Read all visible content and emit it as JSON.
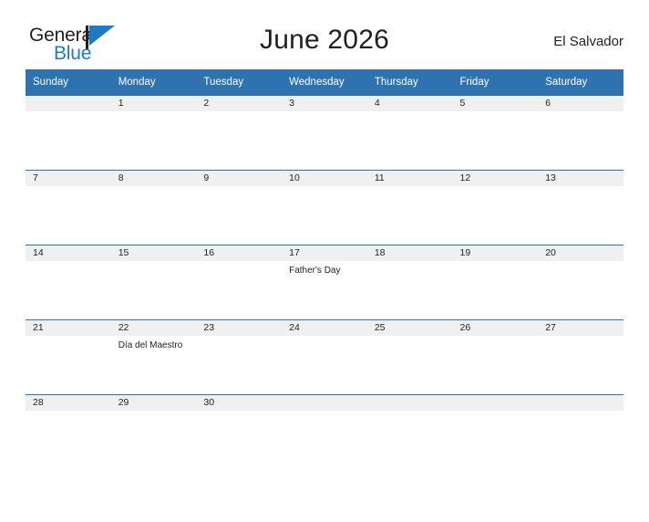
{
  "brand": {
    "word_one": "General",
    "word_two": "Blue",
    "flag_icon": "blue-flag-icon",
    "color_dark": "#231f20",
    "color_blue": "#1f7ac4"
  },
  "header": {
    "title": "June 2026",
    "country": "El Salvador"
  },
  "colors": {
    "header_blue": "#2e72b0",
    "row_divider_blue": "#2e72b0",
    "daynum_band": "#f0f0f0",
    "page_background": "#ffffff",
    "text": "#222222"
  },
  "weekdays": [
    "Sunday",
    "Monday",
    "Tuesday",
    "Wednesday",
    "Thursday",
    "Friday",
    "Saturday"
  ],
  "weeks": [
    [
      {
        "day": "",
        "events": []
      },
      {
        "day": "1",
        "events": []
      },
      {
        "day": "2",
        "events": []
      },
      {
        "day": "3",
        "events": []
      },
      {
        "day": "4",
        "events": []
      },
      {
        "day": "5",
        "events": []
      },
      {
        "day": "6",
        "events": []
      }
    ],
    [
      {
        "day": "7",
        "events": []
      },
      {
        "day": "8",
        "events": []
      },
      {
        "day": "9",
        "events": []
      },
      {
        "day": "10",
        "events": []
      },
      {
        "day": "11",
        "events": []
      },
      {
        "day": "12",
        "events": []
      },
      {
        "day": "13",
        "events": []
      }
    ],
    [
      {
        "day": "14",
        "events": []
      },
      {
        "day": "15",
        "events": []
      },
      {
        "day": "16",
        "events": []
      },
      {
        "day": "17",
        "events": [
          "Father's Day"
        ]
      },
      {
        "day": "18",
        "events": []
      },
      {
        "day": "19",
        "events": []
      },
      {
        "day": "20",
        "events": []
      }
    ],
    [
      {
        "day": "21",
        "events": []
      },
      {
        "day": "22",
        "events": [
          "Día del Maestro"
        ]
      },
      {
        "day": "23",
        "events": []
      },
      {
        "day": "24",
        "events": []
      },
      {
        "day": "25",
        "events": []
      },
      {
        "day": "26",
        "events": []
      },
      {
        "day": "27",
        "events": []
      }
    ],
    [
      {
        "day": "28",
        "events": []
      },
      {
        "day": "29",
        "events": []
      },
      {
        "day": "30",
        "events": []
      },
      {
        "day": "",
        "events": []
      },
      {
        "day": "",
        "events": []
      },
      {
        "day": "",
        "events": []
      },
      {
        "day": "",
        "events": []
      }
    ]
  ]
}
